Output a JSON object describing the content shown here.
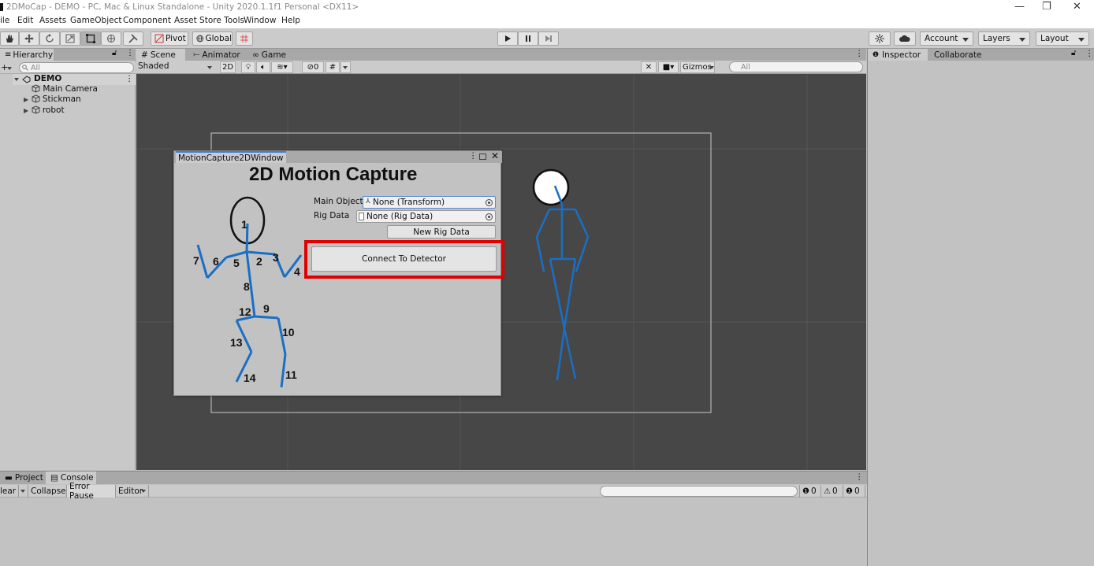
{
  "window": {
    "title": "2DMoCap - DEMO - PC, Mac & Linux Standalone - Unity 2020.1.1f1 Personal <DX11>",
    "minimize": "—",
    "restore": "❐",
    "close": "✕"
  },
  "menu": [
    "ile",
    "Edit",
    "Assets",
    "GameObject",
    "Component",
    "Asset Store Tools",
    "Window",
    "Help"
  ],
  "toolbar": {
    "pivot": "Pivot",
    "global": "Global",
    "account": "Account",
    "layers": "Layers",
    "layout": "Layout"
  },
  "hierarchy": {
    "tab": "Hierarchy",
    "search_placeholder": "All",
    "scene": "DEMO",
    "items": [
      "Main Camera",
      "Stickman",
      "robot"
    ]
  },
  "scene_view": {
    "tabs": [
      "Scene",
      "Animator",
      "Game"
    ],
    "shading": "Shaded",
    "mode_2d": "2D",
    "hidden_count": "0",
    "gizmos": "Gizmos",
    "search_placeholder": "All"
  },
  "inspector": {
    "tabs": [
      "Inspector",
      "Collaborate"
    ]
  },
  "bottom": {
    "tabs": [
      "Project",
      "Console"
    ],
    "clear": "lear",
    "collapse": "Collapse",
    "error_pause": "Error Pause",
    "editor": "Editor",
    "log_count": "0",
    "warn_count": "0",
    "error_count": "0"
  },
  "mocap_window": {
    "tab": "MotionCapture2DWindow",
    "heading": "2D Motion Capture",
    "main_object_label": "Main Object",
    "main_object_value": "None (Transform)",
    "rig_data_label": "Rig Data",
    "rig_data_value": "None (Rig Data)",
    "new_rig_button": "New Rig Data",
    "connect_button": "Connect To Detector",
    "joint_labels": [
      "1",
      "2",
      "3",
      "4",
      "5",
      "6",
      "7",
      "8",
      "9",
      "10",
      "11",
      "12",
      "13",
      "14"
    ]
  },
  "colors": {
    "highlight": "#e00000",
    "stick_blue": "#1a6fc4",
    "scene_bg": "#474747"
  }
}
